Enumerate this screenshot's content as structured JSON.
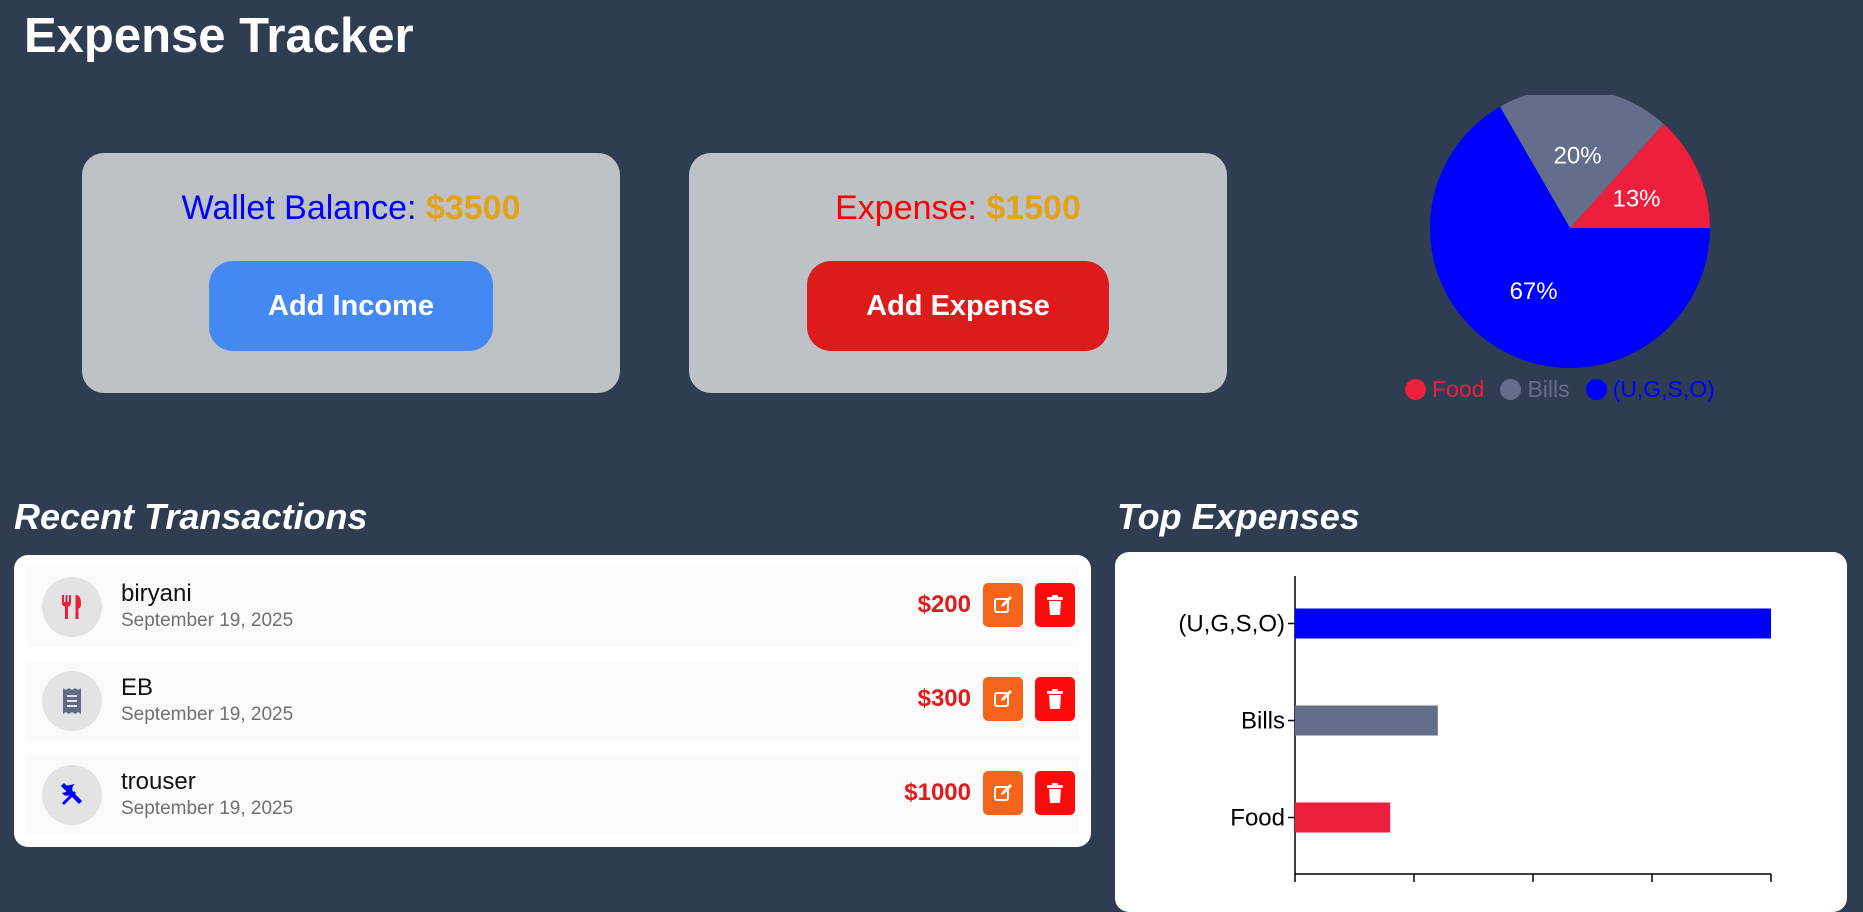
{
  "app": {
    "title": "Expense Tracker"
  },
  "wallet": {
    "label": "Wallet Balance: ",
    "amount": "$3500",
    "button_label": "Add Income",
    "label_color": "#0000ff"
  },
  "expense": {
    "label": "Expense: ",
    "amount": "$1500",
    "button_label": "Add Expense",
    "label_color": "#ff0000"
  },
  "colors": {
    "food": "#ed1f3c",
    "bills": "#636e8a",
    "other": "#0000ff",
    "amount_gold": "#e3a21a"
  },
  "sections": {
    "recent_title": "Recent Transactions",
    "top_title": "Top Expenses"
  },
  "transactions": [
    {
      "name": "biryani",
      "date": "September 19, 2025",
      "amount": "$200",
      "icon": "fork-knife-icon"
    },
    {
      "name": "EB",
      "date": "September 19, 2025",
      "amount": "$300",
      "icon": "receipt-icon"
    },
    {
      "name": "trouser",
      "date": "September 19, 2025",
      "amount": "$1000",
      "icon": "tools-icon"
    }
  ],
  "chart_data": [
    {
      "type": "pie",
      "slices": [
        {
          "name": "Food",
          "value": 200,
          "label": "13%",
          "color": "#ed1f3c"
        },
        {
          "name": "Bills",
          "value": 300,
          "label": "20%",
          "color": "#636e8a"
        },
        {
          "name": "(U,G,S,O)",
          "value": 1000,
          "label": "67%",
          "color": "#0000ff"
        }
      ],
      "legend_position": "bottom"
    },
    {
      "type": "bar",
      "orientation": "horizontal",
      "categories": [
        "(U,G,S,O)",
        "Bills",
        "Food"
      ],
      "values": [
        1000,
        300,
        200
      ],
      "colors": [
        "#0000ff",
        "#636e8a",
        "#ed1f3c"
      ],
      "xlim": [
        0,
        1000
      ],
      "grid": false
    }
  ]
}
